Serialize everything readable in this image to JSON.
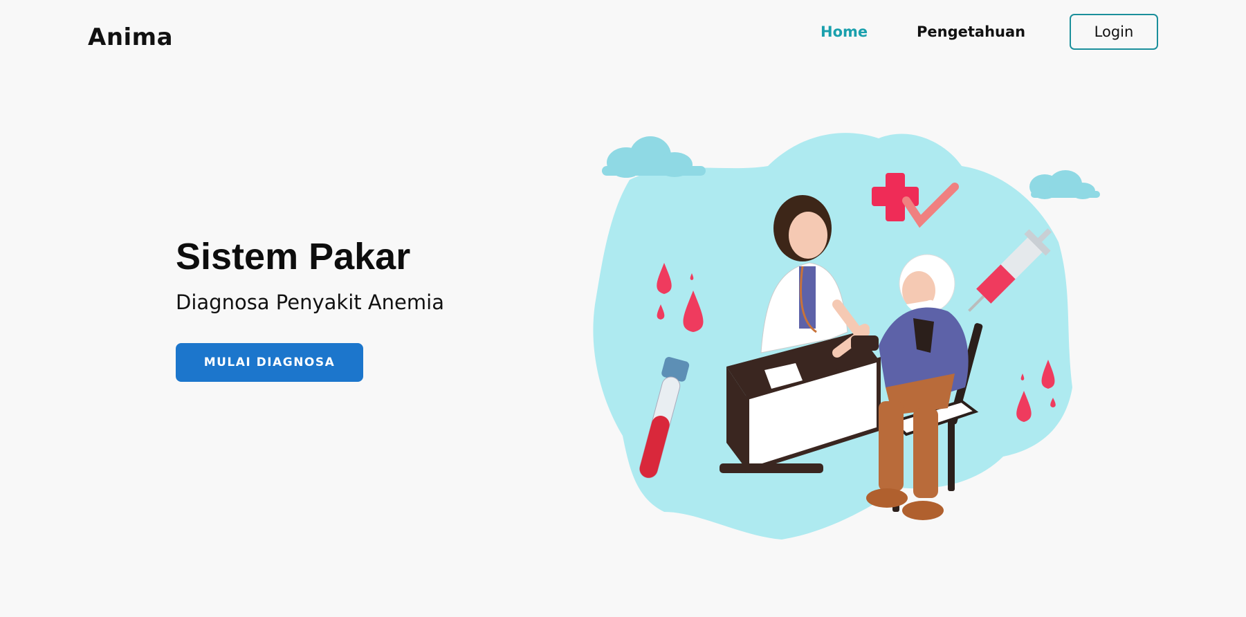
{
  "brand": {
    "name": "Anima"
  },
  "nav": {
    "items": [
      {
        "label": "Home",
        "active": true
      },
      {
        "label": "Pengetahuan",
        "active": false
      }
    ],
    "login_label": "Login"
  },
  "hero": {
    "title": "Sistem Pakar",
    "subtitle": "Diagnosa Penyakit Anemia",
    "cta_label": "MULAI DIAGNOSA"
  },
  "colors": {
    "background": "#f8f8f8",
    "accent_teal": "#1aa0ad",
    "cta_blue": "#1c76cc",
    "illustration_bg": "#aeeaf0",
    "blood_red": "#ef3b5e"
  },
  "illustration": {
    "icons": [
      "cloud-icon",
      "medical-cross-icon",
      "checkmark-icon",
      "blood-drop-icon",
      "test-tube-icon",
      "syringe-icon",
      "doctor-figure",
      "patient-figure",
      "desk",
      "chair"
    ]
  }
}
